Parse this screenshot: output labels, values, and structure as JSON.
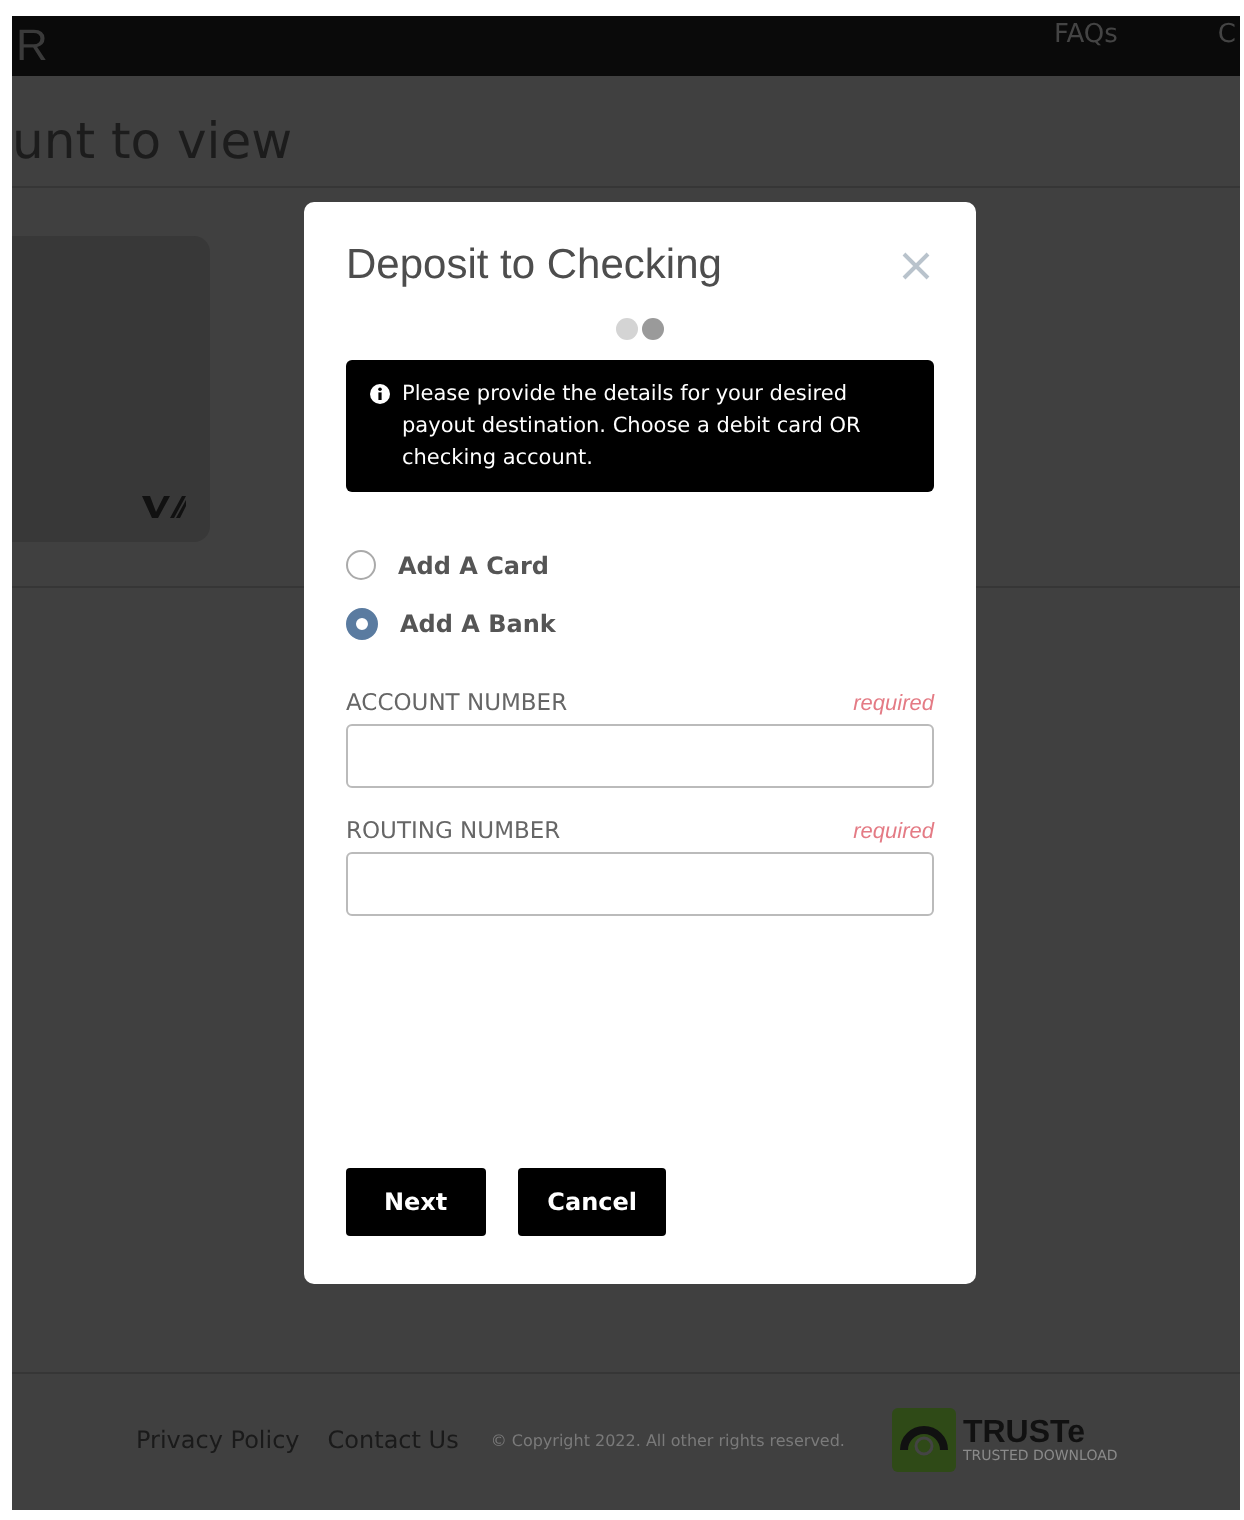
{
  "nav": {
    "brand": "R",
    "links": [
      "FAQs",
      "C"
    ]
  },
  "page": {
    "heading": "unt to view"
  },
  "modal": {
    "title": "Deposit to Checking",
    "steps": [
      {
        "selected": false
      },
      {
        "selected": true
      }
    ],
    "info": "Please provide the details for your desired payout destination. Choose a debit card OR checking account.",
    "options": [
      {
        "label": "Add A Card",
        "selected": false
      },
      {
        "label": "Add A Bank",
        "selected": true
      }
    ],
    "fields": [
      {
        "label": "ACCOUNT NUMBER",
        "hint": "required"
      },
      {
        "label": "ROUTING NUMBER",
        "hint": "required"
      }
    ],
    "buttons": [
      {
        "label": "Next"
      },
      {
        "label": "Cancel"
      }
    ]
  },
  "footer": {
    "links": [
      "Privacy Policy",
      "Contact Us"
    ],
    "copyright": "© Copyright 2022. All other rights reserved.",
    "badge": {
      "title": "TRUSTe",
      "subtitle": "TRUSTED DOWNLOAD"
    }
  }
}
